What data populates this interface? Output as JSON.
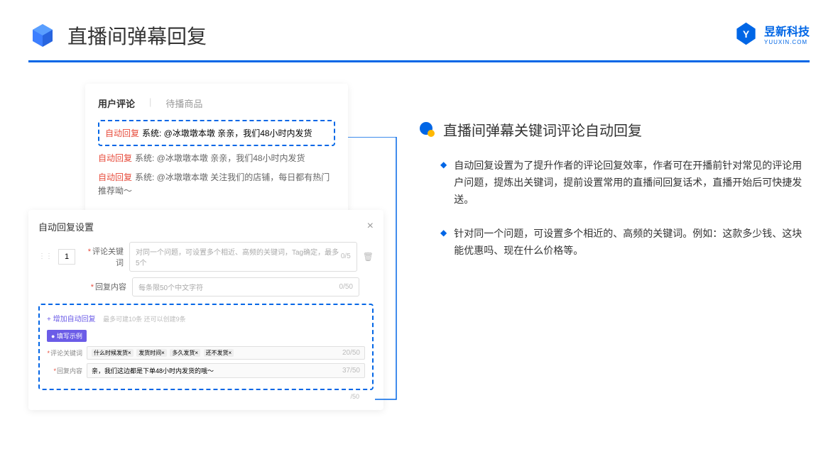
{
  "header": {
    "title": "直播间弹幕回复"
  },
  "logo": {
    "main": "昱新科技",
    "sub": "YUUXIN.COM"
  },
  "card1": {
    "tab1": "用户评论",
    "tab2": "待播商品",
    "reply_tag": "自动回复",
    "line1_sys": "系统: @冰墩墩本墩 亲亲，我们48小时内发货",
    "line2_sys": "系统: @冰墩墩本墩 亲亲，我们48小时内发货",
    "line3_sys": "系统: @冰墩墩本墩 关注我们的店铺，每日都有热门推荐呦～"
  },
  "card2": {
    "title": "自动回复设置",
    "num": "1",
    "label1": "评论关键词",
    "placeholder1": "对同一个问题，可设置多个相近、高频的关键词，Tag确定，最多5个",
    "count1": "0/5",
    "label2": "回复内容",
    "placeholder2": "每条限50个中文字符",
    "count2": "0/50",
    "add_link": "+ 增加自动回复",
    "add_hint": "最多可建10条 还可以创建9条",
    "example_btn": "● 填写示例",
    "ex_label1": "评论关键词",
    "ex_tags": {
      "t1": "什么时候发货×",
      "t2": "发货时间×",
      "t3": "多久发货×",
      "t4": "还不发货×"
    },
    "ex_count1": "20/50",
    "ex_label2": "回复内容",
    "ex_value2": "亲，我们这边都是下单48小时内发货的哦～",
    "ex_count2": "37/50",
    "outer_count": "/50"
  },
  "section": {
    "title": "直播间弹幕关键词评论自动回复",
    "bullet1": "自动回复设置为了提升作者的评论回复效率，作者可在开播前针对常见的评论用户问题，提炼出关键词，提前设置常用的直播间回复话术，直播开始后可快捷发送。",
    "bullet2": "针对同一个问题，可设置多个相近的、高频的关键词。例如：这款多少钱、这块能优惠吗、现在什么价格等。"
  }
}
